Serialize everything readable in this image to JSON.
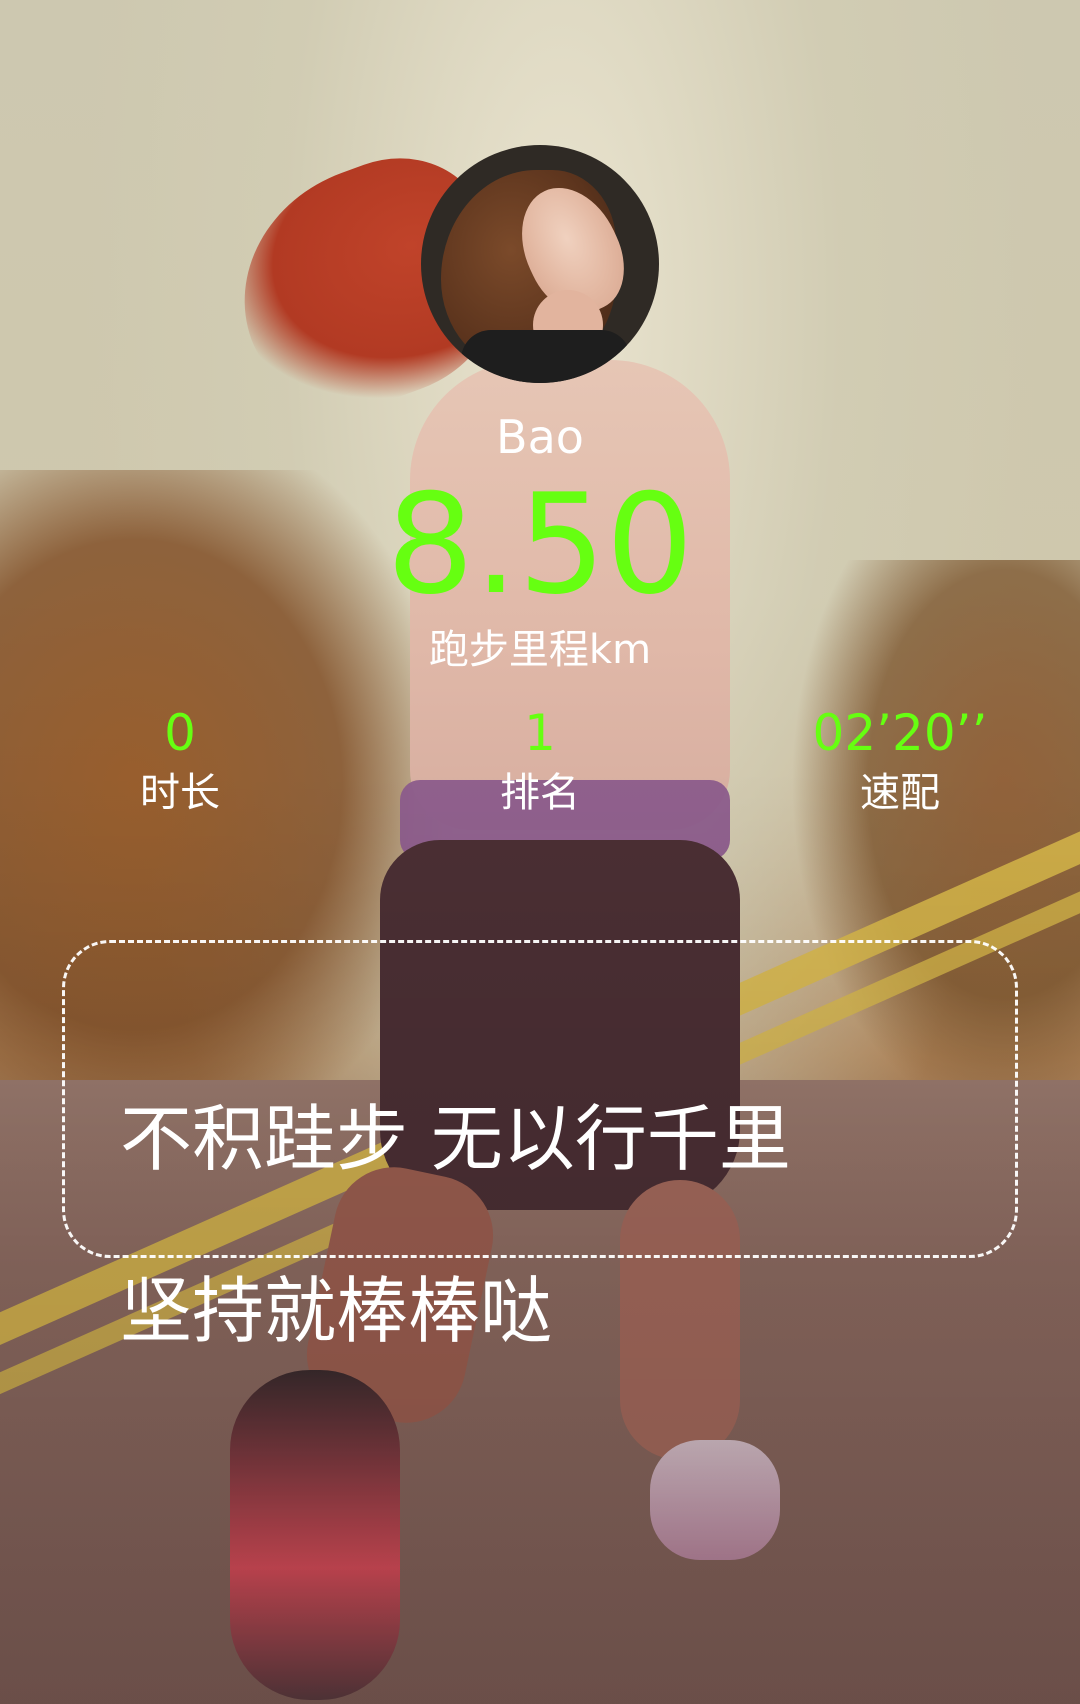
{
  "user": {
    "name": "Bao",
    "avatar_icon": "avatar-photo-icon"
  },
  "run": {
    "distance": "8.50",
    "distance_label": "跑步里程km"
  },
  "stats": [
    {
      "value": "0",
      "label": "时长"
    },
    {
      "value": "1",
      "label": "排名"
    },
    {
      "value": "02’20’’",
      "label": "速配"
    }
  ],
  "quote": {
    "line1": "不积跬步 无以行千里",
    "line2": "坚持就棒棒哒"
  },
  "colors": {
    "accent_green": "#66ff11",
    "text_white": "#ffffff"
  }
}
